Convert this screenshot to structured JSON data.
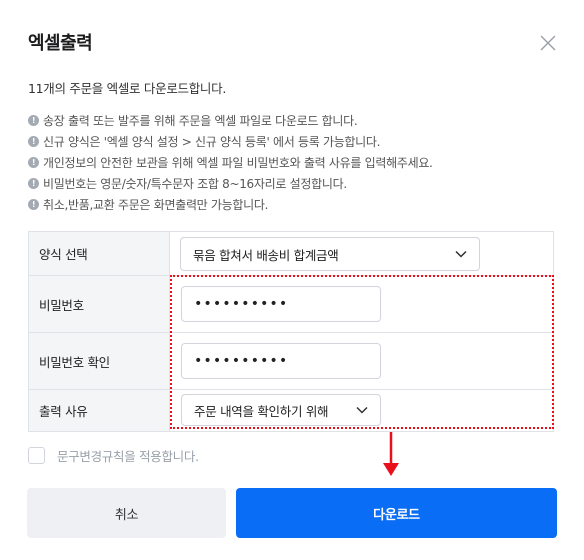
{
  "dialog": {
    "title": "엑셀출력",
    "summary": "11개의 주문을 엑셀로 다운로드합니다.",
    "notes": [
      "송장 출력 또는 발주를 위해 주문을 엑셀 파일로 다운로드 합니다.",
      "신규 양식은 '엑셀 양식 설정 > 신규 양식 등록' 에서 등록 가능합니다.",
      "개인정보의 안전한 보관을 위해 엑셀 파일 비밀번호와 출력 사유를 입력해주세요.",
      "비밀번호는 영문/숫자/특수문자 조합 8~16자리로 설정합니다.",
      "취소,반품,교환 주문은 화면출력만 가능합니다."
    ],
    "note_icon": "info-icon"
  },
  "form": {
    "template_label": "양식 선택",
    "template_value": "묶음 합쳐서 배송비 합계금액",
    "password_label": "비밀번호",
    "password_value": "••••••••••",
    "password_confirm_label": "비밀번호 확인",
    "password_confirm_value": "••••••••••",
    "reason_label": "출력 사유",
    "reason_value": "주문 내역을 확인하기 위해"
  },
  "options": {
    "apply_rules_label": "문구변경규칙을 적용합니다.",
    "apply_rules_checked": false
  },
  "buttons": {
    "cancel": "취소",
    "download": "다운로드"
  },
  "colors": {
    "primary": "#0a6df5",
    "annotation": "#e8101b",
    "label_bg": "#f4f5f7",
    "border": "#dfe2e7"
  }
}
